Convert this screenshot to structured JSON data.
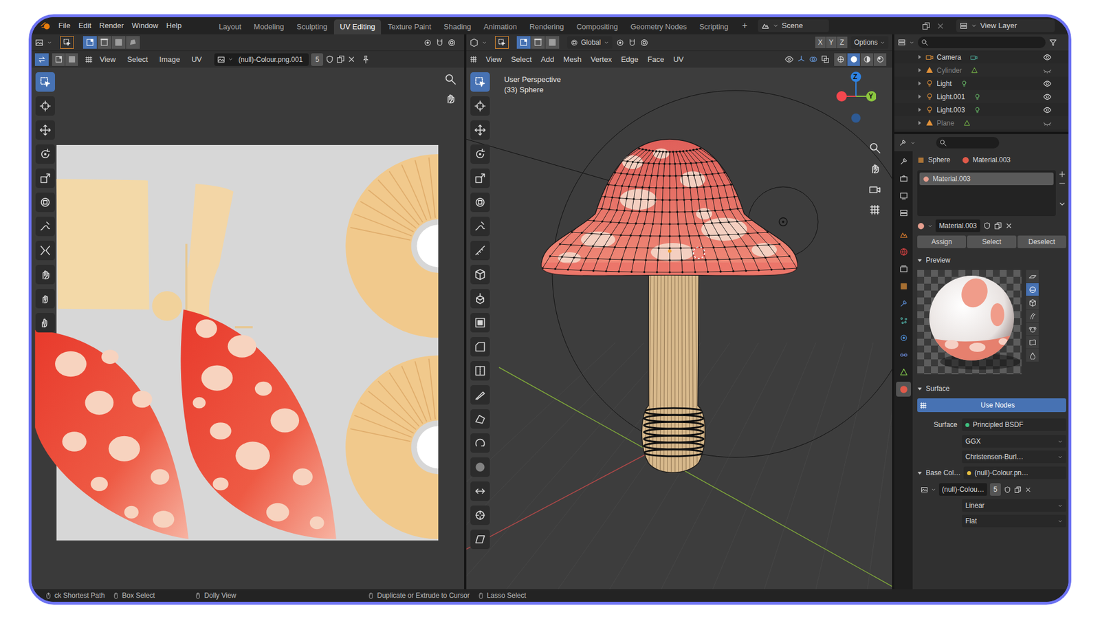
{
  "menu": [
    "File",
    "Edit",
    "Render",
    "Window",
    "Help"
  ],
  "workspaces": [
    {
      "label": "Layout",
      "selected": false
    },
    {
      "label": "Modeling",
      "selected": false
    },
    {
      "label": "Sculpting",
      "selected": false
    },
    {
      "label": "UV Editing",
      "selected": true
    },
    {
      "label": "Texture Paint",
      "selected": false
    },
    {
      "label": "Shading",
      "selected": false
    },
    {
      "label": "Animation",
      "selected": false
    },
    {
      "label": "Rendering",
      "selected": false
    },
    {
      "label": "Compositing",
      "selected": false
    },
    {
      "label": "Geometry Nodes",
      "selected": false
    },
    {
      "label": "Scripting",
      "selected": false
    }
  ],
  "add_workspace": "+",
  "scene": "Scene",
  "view_layer": "View Layer",
  "uv_editor": {
    "menu": [
      "View",
      "Select",
      "Image",
      "UV"
    ],
    "image": "(null)-Colour.png.001",
    "users": "5",
    "select_modes": [
      {
        "selected": true
      },
      {
        "selected": false
      },
      {
        "selected": false
      },
      {
        "selected": false
      }
    ],
    "tools": [
      {
        "selected": true
      },
      {
        "selected": false
      },
      {
        "selected": false
      },
      {
        "selected": false
      },
      {
        "selected": false
      },
      {
        "selected": false
      },
      {
        "selected": false
      },
      {
        "selected": false
      },
      {
        "selected": false
      },
      {
        "selected": false
      },
      {
        "selected": false
      }
    ]
  },
  "viewport": {
    "select_modes": [
      {
        "selected": true
      },
      {
        "selected": false
      },
      {
        "selected": false
      }
    ],
    "orientation": "Global",
    "mirror": [
      {
        "label": "X",
        "on": false
      },
      {
        "label": "Y",
        "on": false
      },
      {
        "label": "Z",
        "on": false
      }
    ],
    "options": "Options",
    "menu": [
      "View",
      "Select",
      "Add",
      "Mesh",
      "Vertex",
      "Edge",
      "Face",
      "UV"
    ],
    "shading": [
      {
        "selected": false
      },
      {
        "selected": true
      },
      {
        "selected": false
      },
      {
        "selected": false
      }
    ],
    "view_name": "User Perspective",
    "object_info": "(33) Sphere",
    "gizmo": [
      "Z",
      "Y"
    ],
    "tools": [
      {
        "selected": true
      },
      {
        "selected": false
      },
      {
        "selected": false
      },
      {
        "selected": false
      },
      {
        "selected": false
      },
      {
        "selected": false
      },
      {
        "selected": false
      },
      {
        "selected": false
      },
      {
        "selected": false
      },
      {
        "selected": false
      },
      {
        "selected": false
      },
      {
        "selected": false
      },
      {
        "selected": false
      },
      {
        "selected": false
      },
      {
        "selected": false
      },
      {
        "selected": false
      },
      {
        "selected": false
      },
      {
        "selected": false
      },
      {
        "selected": false
      },
      {
        "selected": false
      }
    ]
  },
  "outliner": {
    "items": [
      {
        "label": "Camera",
        "kind": "camera",
        "visible": true
      },
      {
        "label": "Cylinder",
        "kind": "mesh",
        "visible": false
      },
      {
        "label": "Light",
        "kind": "light",
        "visible": true
      },
      {
        "label": "Light.001",
        "kind": "light",
        "visible": true
      },
      {
        "label": "Light.003",
        "kind": "light",
        "visible": true
      },
      {
        "label": "Plane",
        "kind": "mesh",
        "visible": false
      }
    ]
  },
  "properties": {
    "tabs": [
      {
        "selected": false
      },
      {
        "selected": false
      },
      {
        "selected": false
      },
      {
        "selected": false
      },
      {
        "selected": false
      },
      {
        "selected": false
      },
      {
        "selected": false
      },
      {
        "selected": false
      },
      {
        "selected": false
      },
      {
        "selected": false
      },
      {
        "selected": false
      },
      {
        "selected": false
      },
      {
        "selected": false
      },
      {
        "selected": true
      }
    ],
    "object": "Sphere",
    "material": "Material.003",
    "slots": [
      {
        "label": "Material.003",
        "selected": true
      }
    ],
    "datablock": "Material.003",
    "actions": [
      "Assign",
      "Select",
      "Deselect"
    ],
    "preview": {
      "title": "Preview",
      "shapes": [
        {
          "selected": false
        },
        {
          "selected": true
        },
        {
          "selected": false
        },
        {
          "selected": false
        },
        {
          "selected": false
        },
        {
          "selected": false
        },
        {
          "selected": false
        }
      ]
    },
    "surface": {
      "title": "Surface",
      "use_nodes": {
        "label": "Use Nodes",
        "on": true
      },
      "shader_label": "Surface",
      "shader": "Principled BSDF",
      "distribution": "GGX",
      "subsurface": "Christensen-Burl…",
      "base_color_label": "Base Col…",
      "base_color": "(null)-Colour.pn…",
      "image": "(null)-Colou…",
      "users": "5",
      "interpolation": "Linear",
      "projection": "Flat"
    }
  },
  "status_bar": [
    "ck Shortest Path",
    "Box Select",
    "Dolly View",
    "Duplicate or Extrude to Cursor",
    "Lasso Select"
  ]
}
